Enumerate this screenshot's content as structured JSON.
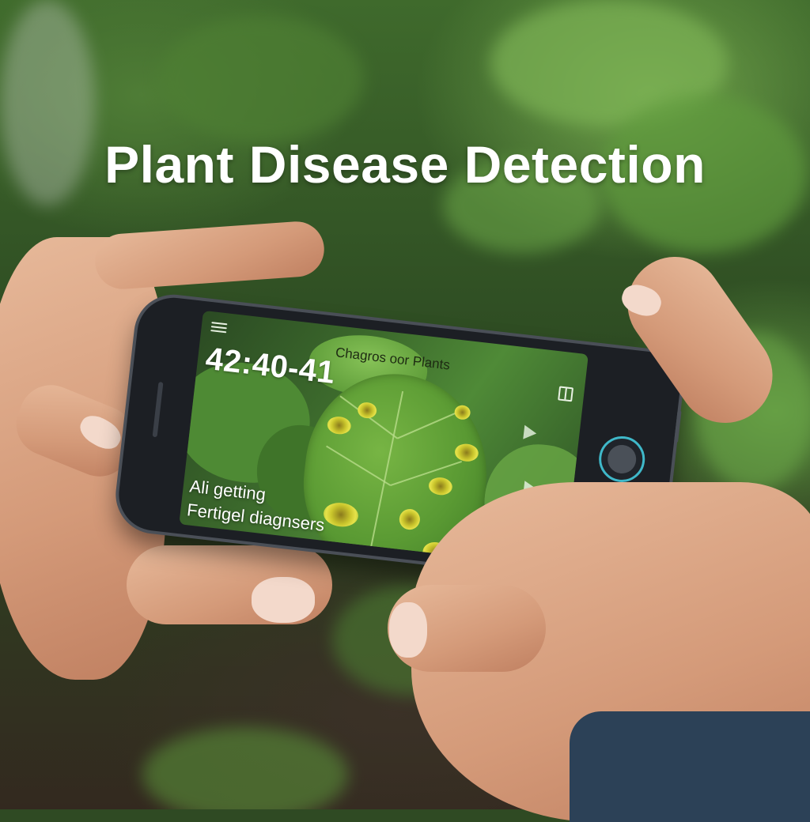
{
  "title": "Plant Disease Detection",
  "app": {
    "clock": "42:40-41",
    "label": "Chagros oor Plants",
    "caption_line1": "Ali getting",
    "caption_line2": "Fertigel diagnsers"
  },
  "colors": {
    "title_text": "#ffffff",
    "shutter_ring": "#3fb8c9",
    "lesion_yellow": "#e6e24a",
    "leaf_green": "#5a9a33"
  },
  "icons": [
    "menu-icon",
    "grid-icon",
    "play-icon",
    "shutter-icon"
  ]
}
